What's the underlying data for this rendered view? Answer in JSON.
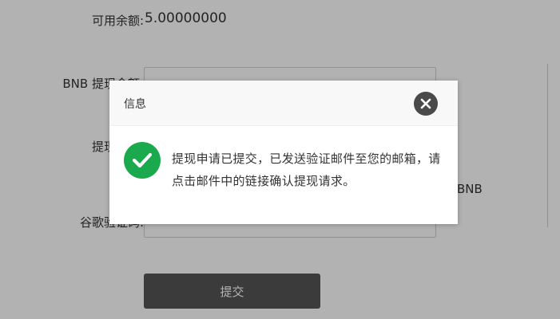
{
  "form": {
    "balance_label": "可用余额:",
    "balance_value": "5.00000000",
    "amount_label": "BNB 提现金额:",
    "address_label": "提现地址:",
    "unit": "BNB",
    "google_code_label": "谷歌验证码:",
    "submit_label": "提交"
  },
  "dialog": {
    "title": "信息",
    "message": "提现申请已提交，已发送验证邮件至您的邮箱，请点击邮件中的链接确认提现请求。",
    "close_icon": "close-icon",
    "status_icon": "check-circle-icon",
    "status_color": "#1aa94d"
  },
  "colors": {
    "overlay": "rgba(0,0,0,0.3)",
    "submit_bg": "#555555"
  }
}
